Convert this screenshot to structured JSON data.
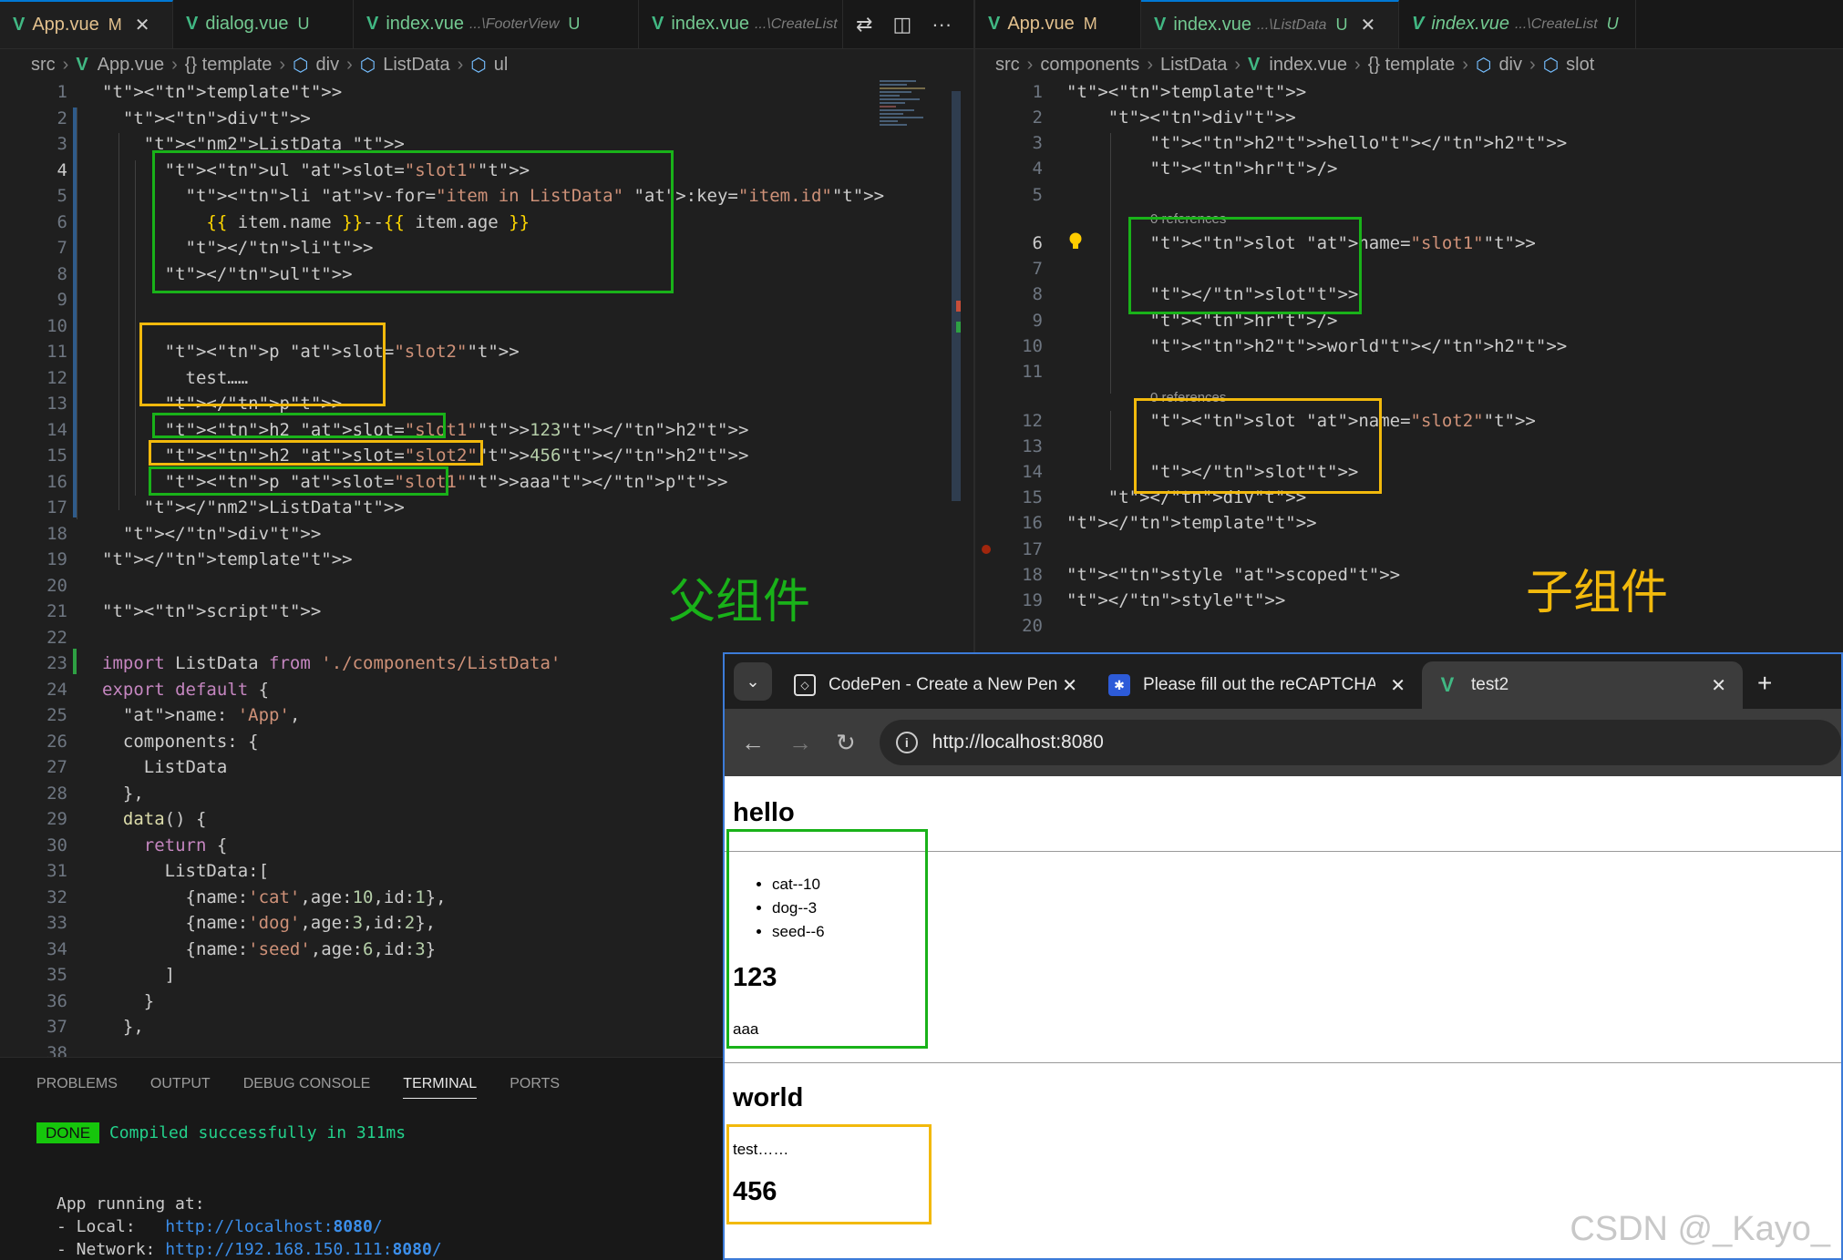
{
  "left_editor": {
    "tabs": [
      {
        "name": "App.vue",
        "dir": "",
        "status": "M",
        "active": true
      },
      {
        "name": "dialog.vue",
        "dir": "",
        "status": "U",
        "active": false
      },
      {
        "name": "index.vue",
        "dir": "...\\FooterView",
        "status": "U",
        "active": false
      },
      {
        "name": "index.vue",
        "dir": "...\\CreateList",
        "status": "",
        "active": false
      }
    ],
    "breadcrumbs": [
      "src",
      "App.vue",
      "{} template",
      "div",
      "ListData",
      "ul"
    ],
    "line_numbers": [
      "1",
      "2",
      "3",
      "4",
      "5",
      "6",
      "7",
      "8",
      "9",
      "10",
      "11",
      "12",
      "13",
      "14",
      "15",
      "16",
      "17",
      "18",
      "19",
      "20",
      "21",
      "22",
      "23",
      "24",
      "25",
      "26",
      "27",
      "28",
      "29",
      "30",
      "31",
      "32",
      "33",
      "34",
      "35",
      "36",
      "37",
      "38"
    ],
    "lines": [
      "<template>",
      "  <div>",
      "    <ListData >",
      "      <ul slot=\"slot1\">",
      "        <li v-for=\"item in ListData\" :key=\"item.id\">",
      "          {{ item.name }}--{{ item.age }}",
      "        </li>",
      "      </ul>",
      "",
      "",
      "      <p slot=\"slot2\">",
      "        test……",
      "      </p>",
      "      <h2 slot=\"slot1\">123</h2>",
      "      <h2 slot=\"slot2\">456</h2>",
      "      <p slot=\"slot1\">aaa</p>",
      "    </ListData>",
      "  </div>",
      "</template>",
      "",
      "<script>",
      "",
      "import ListData from './components/ListData'",
      "export default {",
      "  name: 'App',",
      "  components: {",
      "    ListData",
      "  },",
      "  data() {",
      "    return {",
      "      ListData:[",
      "        {name:'cat',age:10,id:1},",
      "        {name:'dog',age:3,id:2},",
      "        {name:'seed',age:6,id:3}",
      "      ]",
      "    }",
      "  },",
      ""
    ],
    "label_parent": "父组件"
  },
  "right_editor": {
    "tabs": [
      {
        "name": "App.vue",
        "dir": "",
        "status": "M",
        "active": false
      },
      {
        "name": "index.vue",
        "dir": "...\\ListData",
        "status": "U",
        "active": true
      },
      {
        "name": "index.vue",
        "dir": "...\\CreateList",
        "status": "U",
        "active": false
      }
    ],
    "breadcrumbs": [
      "src",
      "components",
      "ListData",
      "index.vue",
      "{} template",
      "div",
      "slot"
    ],
    "line_numbers": [
      "1",
      "2",
      "3",
      "4",
      "5",
      "6",
      "7",
      "8",
      "9",
      "10",
      "11",
      "12",
      "13",
      "14",
      "15",
      "16",
      "17",
      "18",
      "19",
      "20"
    ],
    "references": "0 references",
    "lines": [
      "<template>",
      "    <div>",
      "        <h2>hello</h2>",
      "        <hr/>",
      "",
      "        <slot name=\"slot1\">",
      "",
      "        </slot>",
      "        <hr/>",
      "        <h2>world</h2>",
      "",
      "        <slot name=\"slot2\">",
      "",
      "        </slot>",
      "    </div>",
      "</template>",
      "",
      "<style scoped>",
      "</style>",
      ""
    ],
    "label_child": "子组件"
  },
  "panel": {
    "tabs": [
      "PROBLEMS",
      "OUTPUT",
      "DEBUG CONSOLE",
      "TERMINAL",
      "PORTS"
    ],
    "active_tab": "TERMINAL",
    "done_badge": "DONE",
    "compiled": "Compiled successfully in 311ms",
    "running": "App running at:",
    "local_label": "- Local:   ",
    "local_url_pre": "http://localhost:",
    "local_port": "8080",
    "network_label": "- Network: ",
    "network_url_pre": "http://192.168.150.111:",
    "network_port": "8080"
  },
  "browser": {
    "tabs": [
      {
        "title": "CodePen - Create a New Pen",
        "active": false
      },
      {
        "title": "Please fill out the reCAPTCHA",
        "active": false
      },
      {
        "title": "test2",
        "active": true
      }
    ],
    "url": "http://localhost:8080",
    "page": {
      "h_hello": "hello",
      "list": [
        "cat--10",
        "dog--3",
        "seed--6"
      ],
      "h_123": "123",
      "p_aaa": "aaa",
      "h_world": "world",
      "p_test": "test……",
      "h_456": "456"
    }
  },
  "watermark": "CSDN @_Kayo_",
  "colors": {
    "green_box": "#19b219",
    "yellow_box": "#f2b90c",
    "vue": "#41b883"
  }
}
